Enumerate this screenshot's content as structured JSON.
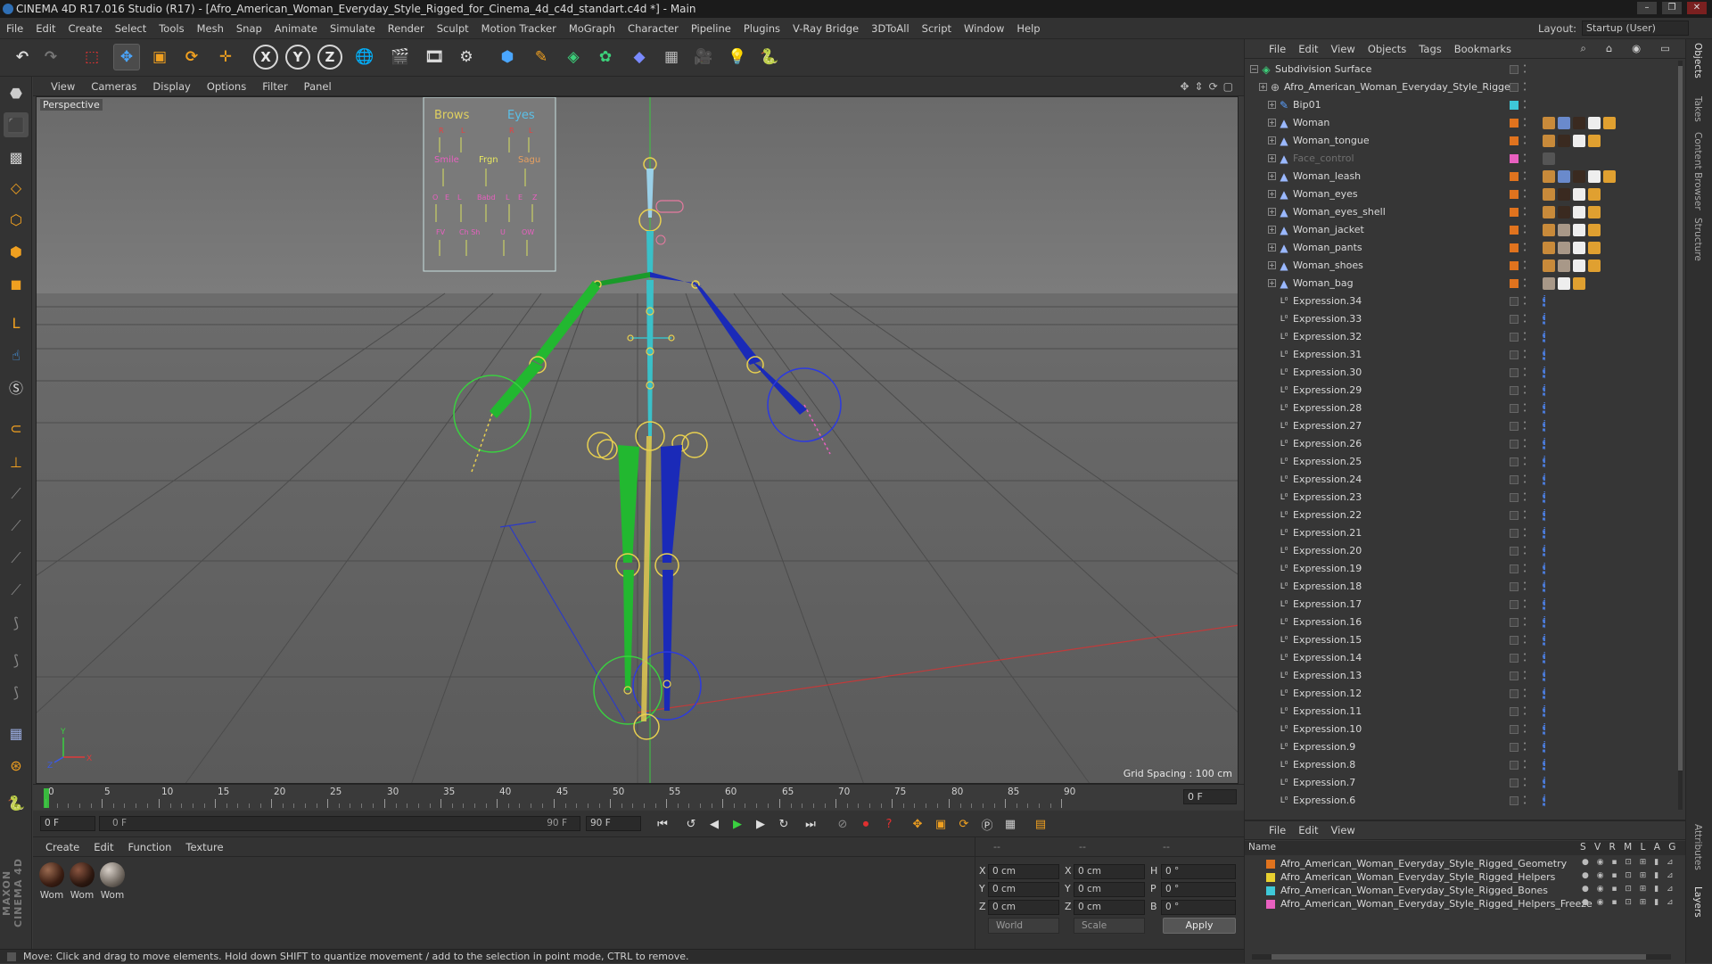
{
  "window": {
    "title": "CINEMA 4D R17.016 Studio (R17) - [Afro_American_Woman_Everyday_Style_Rigged_for_Cinema_4d_c4d_standart.c4d *] - Main",
    "controls": [
      "–",
      "❐",
      "✕"
    ]
  },
  "menubar": {
    "items": [
      "File",
      "Edit",
      "Create",
      "Select",
      "Tools",
      "Mesh",
      "Snap",
      "Animate",
      "Simulate",
      "Render",
      "Sculpt",
      "Motion Tracker",
      "MoGraph",
      "Character",
      "Pipeline",
      "Plugins",
      "V-Ray Bridge",
      "3DToAll",
      "Script",
      "Window",
      "Help"
    ],
    "layout_label": "Layout:",
    "layout_value": "Startup (User)"
  },
  "toolbar": {
    "axis_x": "X",
    "axis_y": "Y",
    "axis_z": "Z"
  },
  "viewport": {
    "menu": [
      "View",
      "Cameras",
      "Display",
      "Options",
      "Filter",
      "Panel"
    ],
    "camera_label": "Perspective",
    "grid_spacing": "Grid Spacing : 100 cm",
    "face_control": {
      "row1": [
        "Brows",
        "Eyes"
      ],
      "row1_sub": [
        "R",
        "L",
        "R",
        "L"
      ],
      "row2": [
        "Smile",
        "Frgn",
        "Sagu"
      ],
      "row3": [
        "O",
        "E",
        "L",
        "Babd",
        "L",
        "E",
        "Z"
      ],
      "row4": [
        "FV",
        "Ch Sh",
        "U",
        "OW"
      ]
    },
    "axis_labels": [
      "Y",
      "Z",
      "X"
    ]
  },
  "timeline": {
    "ticks": [
      "0",
      "5",
      "10",
      "15",
      "20",
      "25",
      "30",
      "35",
      "40",
      "45",
      "50",
      "55",
      "60",
      "65",
      "70",
      "75",
      "80",
      "85",
      "90"
    ],
    "current_frame": "0 F",
    "start_field": "0 F",
    "range_start": "0 F",
    "range_end": "90 F",
    "end_field": "90 F"
  },
  "materials": {
    "menu": [
      "Create",
      "Edit",
      "Function",
      "Texture"
    ],
    "items": [
      "Wom",
      "Wom",
      "Wom"
    ]
  },
  "coordinates": {
    "headers": [
      "--",
      "--",
      "--"
    ],
    "rows": [
      {
        "axis": "X",
        "pos": "0 cm",
        "axis2": "X",
        "size": "0 cm",
        "rot_label": "H",
        "rot": "0 °"
      },
      {
        "axis": "Y",
        "pos": "0 cm",
        "axis2": "Y",
        "size": "0 cm",
        "rot_label": "P",
        "rot": "0 °"
      },
      {
        "axis": "Z",
        "pos": "0 cm",
        "axis2": "Z",
        "size": "0 cm",
        "rot_label": "B",
        "rot": "0 °"
      }
    ],
    "mode": "World",
    "scale": "Scale",
    "apply": "Apply"
  },
  "status": {
    "text": "Move: Click and drag to move elements. Hold down SHIFT to quantize movement / add to the selection in point mode, CTRL to remove."
  },
  "objects": {
    "menu": [
      "File",
      "Edit",
      "View",
      "Objects",
      "Tags",
      "Bookmarks"
    ],
    "rows": [
      {
        "name": "Subdivision Surface",
        "indent": 0,
        "icon": "subdivision-icon",
        "layer": "",
        "tags": []
      },
      {
        "name": "Afro_American_Woman_Everyday_Style_Rigged",
        "indent": 1,
        "icon": "null-icon",
        "layer": "",
        "tags": []
      },
      {
        "name": "Bip01",
        "indent": 2,
        "icon": "bone-icon",
        "layer": "#3ec8d8",
        "tags": []
      },
      {
        "name": "Woman",
        "indent": 2,
        "icon": "polygon-icon",
        "layer": "#e0731e",
        "tags": [
          "#c88a3a",
          "#6a8acc",
          "#3a2a20",
          "#eee",
          "#e0a030"
        ]
      },
      {
        "name": "Woman_tongue",
        "indent": 2,
        "icon": "polygon-icon",
        "layer": "#e0731e",
        "tags": [
          "#c88a3a",
          "#3a2a20",
          "#eee",
          "#e0a030"
        ]
      },
      {
        "name": "Face_control",
        "indent": 2,
        "icon": "polygon-icon",
        "layer": "#e860c0",
        "tags": [
          "#555"
        ],
        "dim": true
      },
      {
        "name": "Woman_leash",
        "indent": 2,
        "icon": "polygon-icon",
        "layer": "#e0731e",
        "tags": [
          "#c88a3a",
          "#6a8acc",
          "#3a2a20",
          "#eee",
          "#e0a030"
        ]
      },
      {
        "name": "Woman_eyes",
        "indent": 2,
        "icon": "polygon-icon",
        "layer": "#e0731e",
        "tags": [
          "#c88a3a",
          "#3a2a20",
          "#eee",
          "#e0a030"
        ]
      },
      {
        "name": "Woman_eyes_shell",
        "indent": 2,
        "icon": "polygon-icon",
        "layer": "#e0731e",
        "tags": [
          "#c88a3a",
          "#3a2a20",
          "#eee",
          "#e0a030"
        ]
      },
      {
        "name": "Woman_jacket",
        "indent": 2,
        "icon": "polygon-icon",
        "layer": "#e0731e",
        "tags": [
          "#c88a3a",
          "#a89888",
          "#eee",
          "#e0a030"
        ]
      },
      {
        "name": "Woman_pants",
        "indent": 2,
        "icon": "polygon-icon",
        "layer": "#e0731e",
        "tags": [
          "#c88a3a",
          "#a89888",
          "#eee",
          "#e0a030"
        ]
      },
      {
        "name": "Woman_shoes",
        "indent": 2,
        "icon": "polygon-icon",
        "layer": "#e0731e",
        "tags": [
          "#c88a3a",
          "#a89888",
          "#eee",
          "#e0a030"
        ]
      },
      {
        "name": "Woman_bag",
        "indent": 2,
        "icon": "polygon-icon",
        "layer": "#e0731e",
        "tags": [
          "#a89888",
          "#eee",
          "#e0a030"
        ]
      },
      {
        "name": "Expression.34",
        "indent": 2,
        "icon": "expression-icon",
        "layer": "",
        "tags": [
          "#4a7ad8"
        ]
      },
      {
        "name": "Expression.33",
        "indent": 2,
        "icon": "expression-icon",
        "layer": "",
        "tags": [
          "#4a7ad8"
        ]
      },
      {
        "name": "Expression.32",
        "indent": 2,
        "icon": "expression-icon",
        "layer": "",
        "tags": [
          "#4a7ad8"
        ]
      },
      {
        "name": "Expression.31",
        "indent": 2,
        "icon": "expression-icon",
        "layer": "",
        "tags": [
          "#4a7ad8"
        ]
      },
      {
        "name": "Expression.30",
        "indent": 2,
        "icon": "expression-icon",
        "layer": "",
        "tags": [
          "#4a7ad8"
        ]
      },
      {
        "name": "Expression.29",
        "indent": 2,
        "icon": "expression-icon",
        "layer": "",
        "tags": [
          "#4a7ad8"
        ]
      },
      {
        "name": "Expression.28",
        "indent": 2,
        "icon": "expression-icon",
        "layer": "",
        "tags": [
          "#4a7ad8"
        ]
      },
      {
        "name": "Expression.27",
        "indent": 2,
        "icon": "expression-icon",
        "layer": "",
        "tags": [
          "#4a7ad8"
        ]
      },
      {
        "name": "Expression.26",
        "indent": 2,
        "icon": "expression-icon",
        "layer": "",
        "tags": [
          "#4a7ad8"
        ]
      },
      {
        "name": "Expression.25",
        "indent": 2,
        "icon": "expression-icon",
        "layer": "",
        "tags": [
          "#4a7ad8"
        ]
      },
      {
        "name": "Expression.24",
        "indent": 2,
        "icon": "expression-icon",
        "layer": "",
        "tags": [
          "#4a7ad8"
        ]
      },
      {
        "name": "Expression.23",
        "indent": 2,
        "icon": "expression-icon",
        "layer": "",
        "tags": [
          "#4a7ad8"
        ]
      },
      {
        "name": "Expression.22",
        "indent": 2,
        "icon": "expression-icon",
        "layer": "",
        "tags": [
          "#4a7ad8"
        ]
      },
      {
        "name": "Expression.21",
        "indent": 2,
        "icon": "expression-icon",
        "layer": "",
        "tags": [
          "#4a7ad8"
        ]
      },
      {
        "name": "Expression.20",
        "indent": 2,
        "icon": "expression-icon",
        "layer": "",
        "tags": [
          "#4a7ad8"
        ]
      },
      {
        "name": "Expression.19",
        "indent": 2,
        "icon": "expression-icon",
        "layer": "",
        "tags": [
          "#4a7ad8"
        ]
      },
      {
        "name": "Expression.18",
        "indent": 2,
        "icon": "expression-icon",
        "layer": "",
        "tags": [
          "#4a7ad8"
        ]
      },
      {
        "name": "Expression.17",
        "indent": 2,
        "icon": "expression-icon",
        "layer": "",
        "tags": [
          "#4a7ad8"
        ]
      },
      {
        "name": "Expression.16",
        "indent": 2,
        "icon": "expression-icon",
        "layer": "",
        "tags": [
          "#4a7ad8"
        ]
      },
      {
        "name": "Expression.15",
        "indent": 2,
        "icon": "expression-icon",
        "layer": "",
        "tags": [
          "#4a7ad8"
        ]
      },
      {
        "name": "Expression.14",
        "indent": 2,
        "icon": "expression-icon",
        "layer": "",
        "tags": [
          "#4a7ad8"
        ]
      },
      {
        "name": "Expression.13",
        "indent": 2,
        "icon": "expression-icon",
        "layer": "",
        "tags": [
          "#4a7ad8"
        ]
      },
      {
        "name": "Expression.12",
        "indent": 2,
        "icon": "expression-icon",
        "layer": "",
        "tags": [
          "#4a7ad8"
        ]
      },
      {
        "name": "Expression.11",
        "indent": 2,
        "icon": "expression-icon",
        "layer": "",
        "tags": [
          "#4a7ad8"
        ]
      },
      {
        "name": "Expression.10",
        "indent": 2,
        "icon": "expression-icon",
        "layer": "",
        "tags": [
          "#4a7ad8"
        ]
      },
      {
        "name": "Expression.9",
        "indent": 2,
        "icon": "expression-icon",
        "layer": "",
        "tags": [
          "#4a7ad8"
        ]
      },
      {
        "name": "Expression.8",
        "indent": 2,
        "icon": "expression-icon",
        "layer": "",
        "tags": [
          "#4a7ad8"
        ]
      },
      {
        "name": "Expression.7",
        "indent": 2,
        "icon": "expression-icon",
        "layer": "",
        "tags": [
          "#4a7ad8"
        ]
      },
      {
        "name": "Expression.6",
        "indent": 2,
        "icon": "expression-icon",
        "layer": "",
        "tags": [
          "#4a7ad8"
        ]
      }
    ]
  },
  "layers": {
    "menu": [
      "File",
      "Edit",
      "View"
    ],
    "header_name": "Name",
    "header_flags": "S V R M L A G",
    "rows": [
      {
        "name": "Afro_American_Woman_Everyday_Style_Rigged_Geometry",
        "color": "#e0731e"
      },
      {
        "name": "Afro_American_Woman_Everyday_Style_Rigged_Helpers",
        "color": "#e8d030"
      },
      {
        "name": "Afro_American_Woman_Everyday_Style_Rigged_Bones",
        "color": "#3ec8d8"
      },
      {
        "name": "Afro_American_Woman_Everyday_Style_Rigged_Helpers_Freeze",
        "color": "#e860c0"
      }
    ]
  },
  "right_tabs": [
    "Objects",
    "Takes",
    "Content Browser",
    "Structure",
    "Attributes",
    "Layers"
  ],
  "maxon_logo": "MAXON CINEMA 4D"
}
